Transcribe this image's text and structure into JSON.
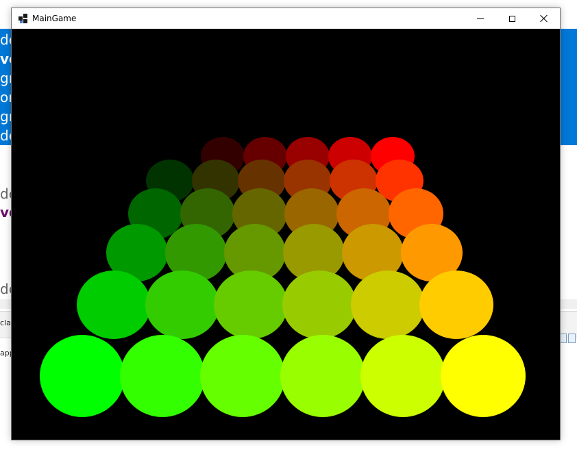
{
  "background": {
    "banner_lines": [
      "de",
      "vo",
      "gr",
      "or",
      "gr",
      "de"
    ],
    "text_de_1": "de",
    "text_vo": "vo",
    "text_de_2": "de",
    "text_cla": "cla",
    "text_app": "app"
  },
  "window": {
    "title": "MainGame",
    "minimize_label": "Minimize",
    "maximize_label": "Maximize",
    "close_label": "Close"
  },
  "game": {
    "background_color": "#000000",
    "grid": {
      "rows": 6,
      "cols": 6
    },
    "sphere_colors": [
      [
        "#330000",
        "#660000",
        "#990000",
        "#cc0000",
        "#ff0000",
        "#ff0000"
      ],
      [
        "#003300",
        "#333300",
        "#663300",
        "#993300",
        "#cc3300",
        "#ff3300"
      ],
      [
        "#006600",
        "#336600",
        "#666600",
        "#996600",
        "#cc6600",
        "#ff6600"
      ],
      [
        "#009900",
        "#339900",
        "#669900",
        "#999900",
        "#cc9900",
        "#ff9900"
      ],
      [
        "#00cc00",
        "#33cc00",
        "#66cc00",
        "#99cc00",
        "#cccc00",
        "#ffcc00"
      ],
      [
        "#00ff00",
        "#33ff00",
        "#66ff00",
        "#99ff00",
        "#ccff00",
        "#ffff00"
      ]
    ]
  }
}
